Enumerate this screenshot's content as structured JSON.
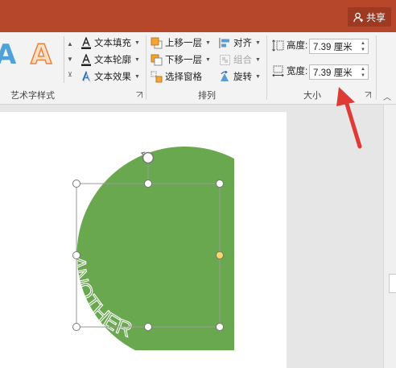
{
  "titlebar": {
    "share_label": "共享",
    "color": "#b7472a"
  },
  "ribbon": {
    "wordart_styles": {
      "label": "艺术字样式",
      "samples": [
        {
          "glyph": "A",
          "style": "blue-fill"
        },
        {
          "glyph": "A",
          "style": "orange-outline"
        }
      ],
      "text_fill_label": "文本填充",
      "text_outline_label": "文本轮廓",
      "text_effects_label": "文本效果"
    },
    "arrange": {
      "label": "排列",
      "bring_forward_label": "上移一层",
      "send_backward_label": "下移一层",
      "selection_pane_label": "选择窗格",
      "align_label": "对齐",
      "group_label": "组合",
      "rotate_label": "旋转"
    },
    "size": {
      "label": "大小",
      "height_label": "高度:",
      "height_value": "7.39 厘米",
      "width_label": "宽度:",
      "width_value": "7.39 厘米"
    }
  },
  "slide": {
    "shape_text": "ANOTHER",
    "shape_color": "#6aa84f",
    "annotation_color": "#e03a36"
  }
}
